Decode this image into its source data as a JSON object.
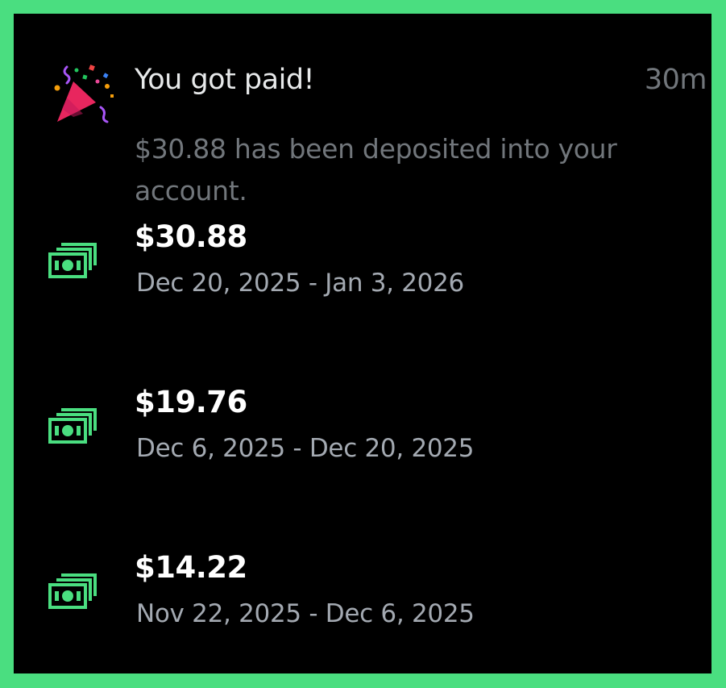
{
  "colors": {
    "border": "#4ade80",
    "background": "#000000",
    "money_icon": "#4ade80",
    "title_text": "#e7e9ea",
    "muted_text": "#71767b",
    "amount_text": "#ffffff",
    "period_text": "#a3a9b1"
  },
  "notification": {
    "icon": "party-popper-icon",
    "title": "You got paid!",
    "time": "30m",
    "body": "$30.88 has been deposited into your account."
  },
  "payments": [
    {
      "icon": "money-icon",
      "amount": "$30.88",
      "period": "Dec 20, 2025 - Jan 3, 2026"
    },
    {
      "icon": "money-icon",
      "amount": "$19.76",
      "period": "Dec 6, 2025 - Dec 20, 2025"
    },
    {
      "icon": "money-icon",
      "amount": "$14.22",
      "period": "Nov 22, 2025 - Dec 6, 2025"
    }
  ]
}
